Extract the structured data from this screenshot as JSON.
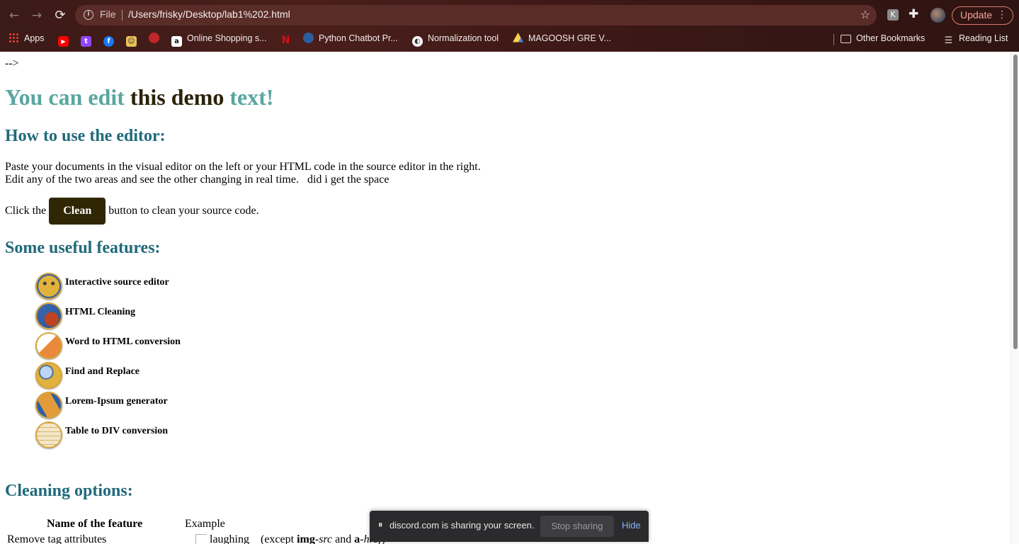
{
  "browser": {
    "scheme_label": "File",
    "url": "/Users/frisky/Desktop/lab1%202.html",
    "update_label": "Update",
    "extension_letter": "K",
    "bookmarks": [
      {
        "label": "Apps",
        "icon": "apps-grid-icon"
      },
      {
        "label": "",
        "icon": "youtube-icon"
      },
      {
        "label": "",
        "icon": "twitch-icon"
      },
      {
        "label": "",
        "icon": "facebook-icon"
      },
      {
        "label": "",
        "icon": "character-icon"
      },
      {
        "label": "",
        "icon": "apple-icon"
      },
      {
        "label": "Online Shopping s...",
        "icon": "amazon-icon"
      },
      {
        "label": "",
        "icon": "netflix-icon"
      },
      {
        "label": "Python Chatbot Pr...",
        "icon": "site-icon"
      },
      {
        "label": "Normalization tool",
        "icon": "globe-icon"
      },
      {
        "label": "MAGOOSH GRE V...",
        "icon": "drive-icon"
      }
    ],
    "other_bookmarks": "Other Bookmarks",
    "reading_list": "Reading List"
  },
  "page": {
    "leftover": "-->",
    "title_parts": [
      "You can edit ",
      "this demo",
      " text!"
    ],
    "howto_title": "How to use the editor:",
    "para_line1": "Paste your documents in the visual editor on the left or your HTML code in the source editor in the right.",
    "para_line2": "Edit any of the two areas and see the other changing in real time.   did i get the space",
    "click_prefix": "Click the",
    "clean_label": "Clean",
    "click_suffix": "button to clean your source code.",
    "features_title": "Some useful features:",
    "features": [
      {
        "label": "Interactive source editor",
        "icon": "smiley-icon"
      },
      {
        "label": "HTML Cleaning",
        "icon": "broom-bucket-icon"
      },
      {
        "label": "Word to HTML conversion",
        "icon": "word-icon"
      },
      {
        "label": "Find and Replace",
        "icon": "magnifier-icon"
      },
      {
        "label": "Lorem-Ipsum generator",
        "icon": "papyrus-icon"
      },
      {
        "label": "Table to DIV conversion",
        "icon": "table-arrow-icon"
      }
    ],
    "cleaning_title": "Cleaning options:",
    "table_head_name": "Name of the feature",
    "table_head_example": "Example",
    "row1_name": "Remove tag attributes",
    "row1_alt": "laughing",
    "row1_ex_prefix": "(except ",
    "row1_ex_b1": "img",
    "row1_ex_i1": "-src",
    "row1_ex_mid": " and ",
    "row1_ex_b2": "a",
    "row1_ex_i2": "-href",
    "row1_ex_suffix": ")"
  },
  "share_bar": {
    "message": "discord.com is sharing your screen.",
    "stop_label": "Stop sharing",
    "hide_label": "Hide"
  },
  "colors": {
    "title_teal": "#5aa6a0",
    "title_dark": "#2c2208",
    "heading_teal": "#1f6a7a",
    "clean_button": "#2f2604"
  }
}
